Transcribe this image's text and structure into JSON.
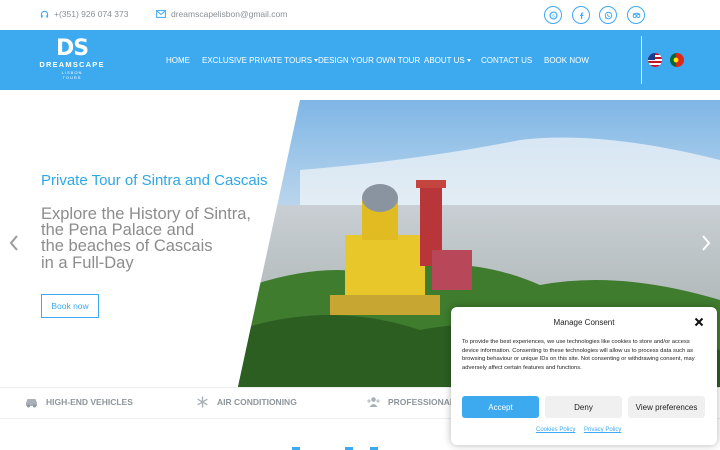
{
  "topbar": {
    "phone": "+(351) 926 074 373",
    "email": "dreamscapelisbon@gmail.com",
    "social_icons": [
      "skype-icon",
      "facebook-icon",
      "whatsapp-icon",
      "tripadvisor-icon"
    ]
  },
  "logo": {
    "mark": "DS",
    "name": "DREAMSCAPE",
    "sub1": "LISBON",
    "sub2": "TOURS"
  },
  "nav": {
    "items": [
      {
        "label": "HOME",
        "dropdown": false
      },
      {
        "label": "EXCLUSIVE PRIVATE TOURS",
        "dropdown": true
      },
      {
        "label": "DESIGN YOUR OWN TOUR",
        "dropdown": false
      },
      {
        "label": "ABOUT US",
        "dropdown": true
      },
      {
        "label": "CONTACT US",
        "dropdown": false
      },
      {
        "label": "BOOK NOW",
        "dropdown": false
      }
    ],
    "languages": [
      "english-flag-icon",
      "portuguese-flag-icon"
    ]
  },
  "hero": {
    "title": "Private Tour of Sintra and Cascais",
    "lines": [
      "Explore the History of Sintra,",
      "the Pena Palace and",
      "the beaches of Cascais",
      "in a Full-Day"
    ],
    "button": "Book now"
  },
  "features": [
    {
      "label": "HIGH-END VEHICLES",
      "icon": "car-icon"
    },
    {
      "label": "AIR CONDITIONING",
      "icon": "snowflake-icon"
    },
    {
      "label": "PROFESSIONAL",
      "icon": "users-icon"
    }
  ],
  "consent": {
    "title": "Manage Consent",
    "body": "To provide the best experiences, we use technologies like cookies to store and/or access device information. Consenting to these technologies will allow us to process data such as browsing behaviour or unique IDs on this site. Not consenting or withdrawing consent, may adversely affect certain features and functions.",
    "accept": "Accept",
    "deny": "Deny",
    "preferences": "View preferences",
    "cookies_policy": "Cookies Policy",
    "privacy_policy": "Privacy Policy"
  },
  "colors": {
    "brand": "#3daaf0",
    "accent_text": "#2fa7e6",
    "muted": "#8c8c8c"
  }
}
